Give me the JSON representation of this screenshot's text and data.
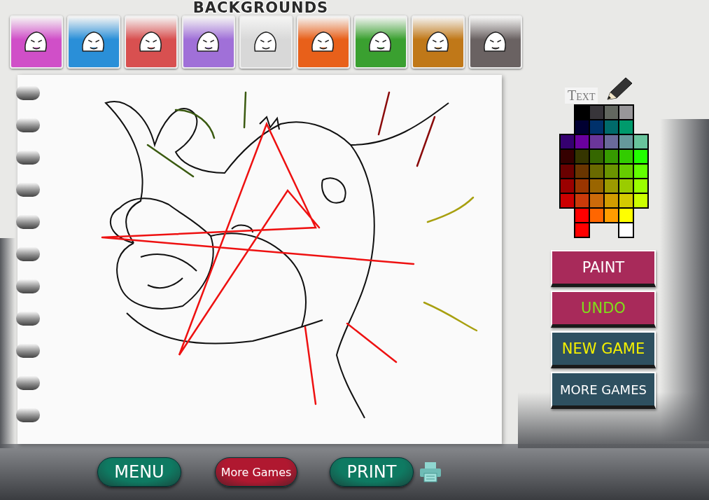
{
  "backgrounds": {
    "title": "BACKGROUNDS",
    "thumbnails": [
      {
        "color": "#d04fc8"
      },
      {
        "color": "#2a8fd8"
      },
      {
        "color": "#d85050"
      },
      {
        "color": "#a070d8"
      },
      {
        "color": "#d8d8d8"
      },
      {
        "color": "#e8601a"
      },
      {
        "color": "#3aa030"
      },
      {
        "color": "#c07818"
      },
      {
        "color": "#6a6262"
      }
    ]
  },
  "palette": {
    "label": "Text",
    "rows": [
      [
        {
          "kind": "empty"
        },
        {
          "kind": "swatch",
          "color": "#000000"
        },
        {
          "kind": "swatch",
          "color": "#38353a"
        },
        {
          "kind": "swatch",
          "color": "#62675f"
        },
        {
          "kind": "swatch",
          "color": "#989699"
        },
        {
          "kind": "empty"
        }
      ],
      [
        {
          "kind": "empty"
        },
        {
          "kind": "swatch",
          "color": "#010032"
        },
        {
          "kind": "swatch",
          "color": "#00316b"
        },
        {
          "kind": "swatch",
          "color": "#006a6a"
        },
        {
          "kind": "swatch",
          "color": "#009a6c"
        },
        {
          "kind": "empty"
        }
      ],
      [
        {
          "kind": "swatch",
          "color": "#350070"
        },
        {
          "kind": "swatch",
          "color": "#6a009e"
        },
        {
          "kind": "swatch",
          "color": "#6b369b"
        },
        {
          "kind": "swatch",
          "color": "#6a6a9a"
        },
        {
          "kind": "swatch",
          "color": "#65999b"
        },
        {
          "kind": "swatch",
          "color": "#68c49c"
        }
      ],
      [
        {
          "kind": "swatch",
          "color": "#350000"
        },
        {
          "kind": "swatch",
          "color": "#353500"
        },
        {
          "kind": "swatch",
          "color": "#356700"
        },
        {
          "kind": "swatch",
          "color": "#369a00"
        },
        {
          "kind": "swatch",
          "color": "#32cc00"
        },
        {
          "kind": "swatch",
          "color": "#21ff00"
        }
      ],
      [
        {
          "kind": "swatch",
          "color": "#6a0000"
        },
        {
          "kind": "swatch",
          "color": "#6a3500"
        },
        {
          "kind": "swatch",
          "color": "#6a6a00"
        },
        {
          "kind": "swatch",
          "color": "#6a9400"
        },
        {
          "kind": "swatch",
          "color": "#66cc00"
        },
        {
          "kind": "swatch",
          "color": "#62ff00"
        }
      ],
      [
        {
          "kind": "swatch",
          "color": "#9b0000"
        },
        {
          "kind": "swatch",
          "color": "#9a3500"
        },
        {
          "kind": "swatch",
          "color": "#9a6500"
        },
        {
          "kind": "swatch",
          "color": "#9c9a00"
        },
        {
          "kind": "swatch",
          "color": "#9acc00"
        },
        {
          "kind": "swatch",
          "color": "#9aff00"
        }
      ],
      [
        {
          "kind": "swatch",
          "color": "#cc0000"
        },
        {
          "kind": "swatch",
          "color": "#cb3a0a"
        },
        {
          "kind": "swatch",
          "color": "#cb6a0a"
        },
        {
          "kind": "swatch",
          "color": "#d29c00"
        },
        {
          "kind": "swatch",
          "color": "#d4ca00"
        },
        {
          "kind": "swatch",
          "color": "#ccff00"
        }
      ],
      [
        {
          "kind": "empty"
        },
        {
          "kind": "swatch",
          "color": "#ff0000"
        },
        {
          "kind": "swatch",
          "color": "#ff6600"
        },
        {
          "kind": "swatch",
          "color": "#ff9c00"
        },
        {
          "kind": "swatch",
          "color": "#ffff00"
        },
        {
          "kind": "empty"
        }
      ],
      [
        {
          "kind": "empty"
        },
        {
          "kind": "swatch",
          "color": "#ff0000"
        },
        {
          "kind": "empty"
        },
        {
          "kind": "empty"
        },
        {
          "kind": "swatch",
          "color": "#ffffff"
        },
        {
          "kind": "empty"
        }
      ]
    ]
  },
  "side_buttons": [
    {
      "label": "PAINT",
      "color": "#a82a5a"
    },
    {
      "label": "UNDO",
      "color": "#a82a5a"
    },
    {
      "label": "NEW GAME",
      "color": "#2e5060"
    },
    {
      "label": "MORE GAMES",
      "color": "#2e5060"
    }
  ],
  "bottom_buttons": [
    {
      "label": "MENU",
      "color": "#0e7a62"
    },
    {
      "label": "More Games",
      "color": "#b01830"
    },
    {
      "label": "PRINT",
      "color": "#0e7a62"
    }
  ]
}
